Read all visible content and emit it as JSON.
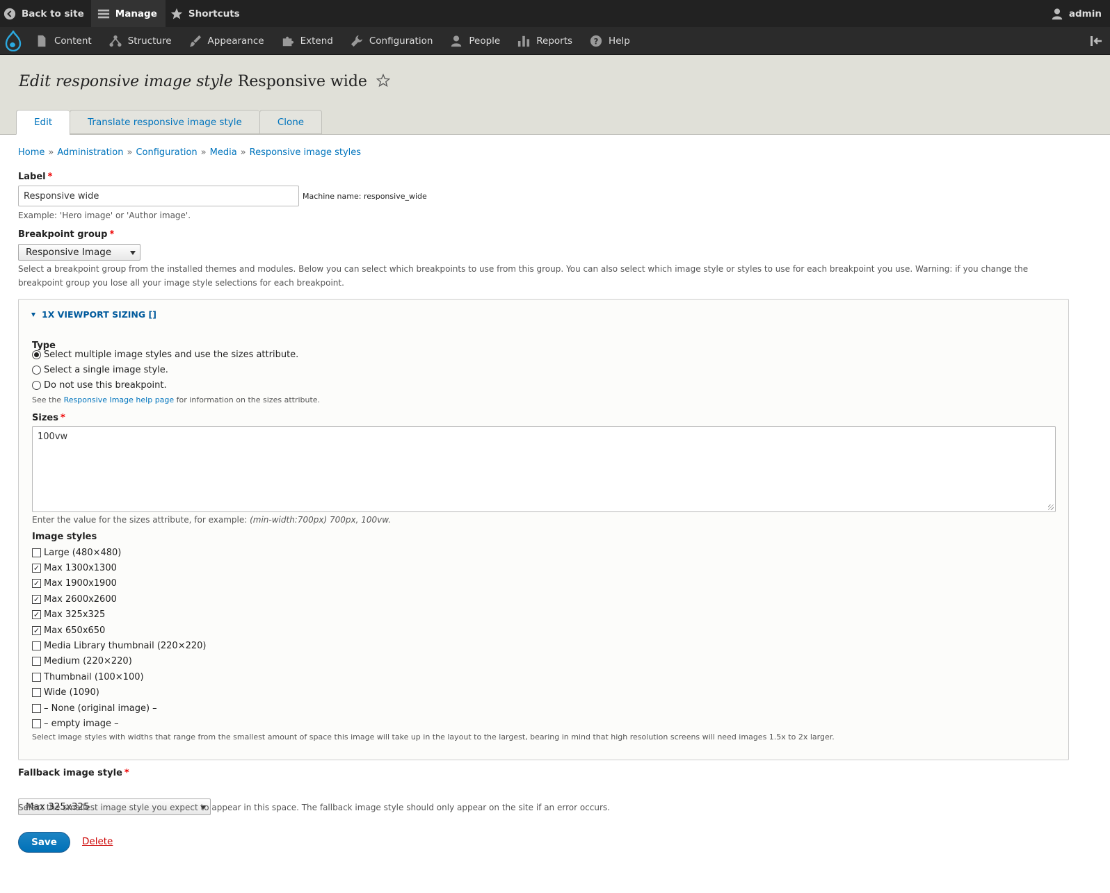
{
  "toolbar": {
    "back_label": "Back to site",
    "manage_label": "Manage",
    "shortcuts_label": "Shortcuts",
    "user_label": "admin"
  },
  "admin_menu": {
    "items": [
      {
        "label": "Content",
        "icon": "file-icon"
      },
      {
        "label": "Structure",
        "icon": "structure-icon"
      },
      {
        "label": "Appearance",
        "icon": "brush-icon"
      },
      {
        "label": "Extend",
        "icon": "puzzle-icon"
      },
      {
        "label": "Configuration",
        "icon": "wrench-icon"
      },
      {
        "label": "People",
        "icon": "person-icon"
      },
      {
        "label": "Reports",
        "icon": "bar-chart-icon"
      },
      {
        "label": "Help",
        "icon": "help-icon"
      }
    ]
  },
  "header": {
    "title_em": "Edit responsive image style",
    "title_rest": "Responsive wide",
    "tabs": [
      {
        "label": "Edit",
        "active": true
      },
      {
        "label": "Translate responsive image style",
        "active": false
      },
      {
        "label": "Clone",
        "active": false
      }
    ]
  },
  "breadcrumb": [
    "Home",
    "Administration",
    "Configuration",
    "Media",
    "Responsive image styles"
  ],
  "breadcrumb_sep": "»",
  "form": {
    "label_field": {
      "label": "Label",
      "required_mark": "*",
      "value": "Responsive wide",
      "machine_name": "Machine name: responsive_wide",
      "description": "Example: 'Hero image' or 'Author image'."
    },
    "breakpoint_group": {
      "label": "Breakpoint group",
      "required_mark": "*",
      "selected": "Responsive Image",
      "description": "Select a breakpoint group from the installed themes and modules. Below you can select which breakpoints to use from this group. You can also select which image style or styles to use for each breakpoint you use. Warning: if you change the breakpoint group you lose all your image style selections for each breakpoint."
    },
    "fieldset": {
      "legend": "1X VIEWPORT SIZING []",
      "type_label": "Type",
      "type_options": [
        {
          "label": "Select multiple image styles and use the sizes attribute.",
          "checked": true
        },
        {
          "label": "Select a single image style.",
          "checked": false
        },
        {
          "label": "Do not use this breakpoint.",
          "checked": false
        }
      ],
      "type_desc_pre": "See the",
      "type_desc_link": "Responsive Image help page",
      "type_desc_post": "for information on the sizes attribute.",
      "sizes_label": "Sizes",
      "sizes_required_mark": "*",
      "sizes_value": "100vw",
      "sizes_desc_pre": "Enter the value for the sizes attribute, for example:",
      "sizes_desc_example": "(min-width:700px) 700px, 100vw.",
      "image_styles_label": "Image styles",
      "image_styles": [
        {
          "label": "Large (480×480)",
          "checked": false
        },
        {
          "label": "Max 1300x1300",
          "checked": true
        },
        {
          "label": "Max 1900x1900",
          "checked": true
        },
        {
          "label": "Max 2600x2600",
          "checked": true
        },
        {
          "label": "Max 325x325",
          "checked": true
        },
        {
          "label": "Max 650x650",
          "checked": true
        },
        {
          "label": "Media Library thumbnail (220×220)",
          "checked": false
        },
        {
          "label": "Medium (220×220)",
          "checked": false
        },
        {
          "label": "Thumbnail (100×100)",
          "checked": false
        },
        {
          "label": "Wide (1090)",
          "checked": false
        },
        {
          "label": "– None (original image) –",
          "checked": false
        },
        {
          "label": "– empty image –",
          "checked": false
        }
      ],
      "image_styles_desc": "Select image styles with widths that range from the smallest amount of space this image will take up in the layout to the largest, bearing in mind that high resolution screens will need images 1.5x to 2x larger."
    },
    "fallback": {
      "label": "Fallback image style",
      "required_mark": "*",
      "selected": "Max 325x325",
      "description": "Select the smallest image style you expect to appear in this space. The fallback image style should only appear on the site if an error occurs."
    },
    "actions": {
      "save_label": "Save",
      "delete_label": "Delete"
    }
  },
  "colors": {
    "link": "#0074bd",
    "required": "#e00000",
    "toolbar": "#222222",
    "header_bg": "#e0e0d8",
    "save_button": "#0071b8"
  }
}
